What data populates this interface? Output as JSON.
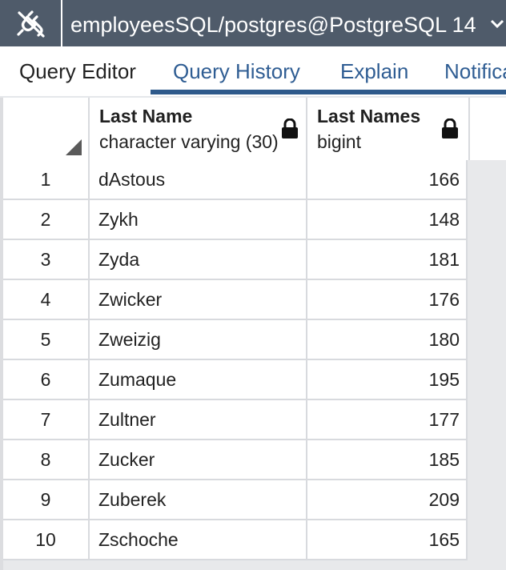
{
  "connection": {
    "title": "employeesSQL/postgres@PostgreSQL 14",
    "icon": "plug-disconnected-icon",
    "caret_icon": "chevron-down-icon"
  },
  "tabs": [
    {
      "label": "Query Editor",
      "active": true
    },
    {
      "label": "Query History",
      "active": false
    },
    {
      "label": "Explain",
      "active": false
    },
    {
      "label": "Notifications",
      "active": false
    }
  ],
  "grid": {
    "columns": [
      {
        "name": "Last Name",
        "type": "character varying (30)",
        "icon": "lock-icon"
      },
      {
        "name": "Last Names",
        "type": "bigint",
        "icon": "lock-icon"
      }
    ],
    "rows": [
      {
        "num": "1",
        "last_name": "dAstous",
        "count": "166"
      },
      {
        "num": "2",
        "last_name": "Zykh",
        "count": "148"
      },
      {
        "num": "3",
        "last_name": "Zyda",
        "count": "181"
      },
      {
        "num": "4",
        "last_name": "Zwicker",
        "count": "176"
      },
      {
        "num": "5",
        "last_name": "Zweizig",
        "count": "180"
      },
      {
        "num": "6",
        "last_name": "Zumaque",
        "count": "195"
      },
      {
        "num": "7",
        "last_name": "Zultner",
        "count": "177"
      },
      {
        "num": "8",
        "last_name": "Zucker",
        "count": "185"
      },
      {
        "num": "9",
        "last_name": "Zuberek",
        "count": "209"
      },
      {
        "num": "10",
        "last_name": "Zschoche",
        "count": "165"
      }
    ]
  },
  "colors": {
    "connection_bar": "#4f5b6a",
    "active_tab_accent": "#2e5a8b",
    "tab_link": "#2f5d93"
  }
}
